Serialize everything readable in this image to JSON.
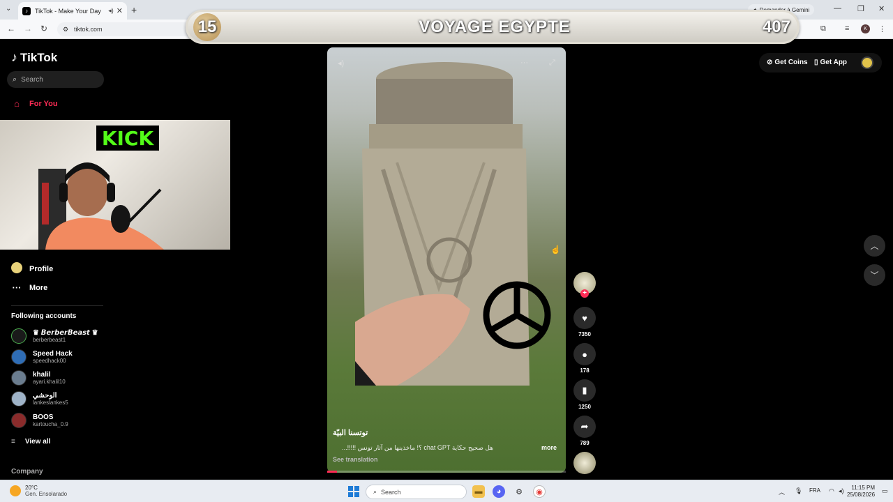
{
  "browser": {
    "tab_title": "TikTok - Make Your Day",
    "url": "tiktok.com",
    "gemini_label": "Demander à Gemini"
  },
  "overlay": {
    "number": "15",
    "title": "VOYAGE EGYPTE",
    "score": "407"
  },
  "sidebar": {
    "logo": "TikTok",
    "search_placeholder": "Search",
    "items": {
      "for_you": "For You",
      "profile": "Profile",
      "more": "More"
    },
    "following_title": "Following accounts",
    "accounts": [
      {
        "name": "♛ 𝘽𝙚𝙧𝙗𝙚𝙧𝘽𝙚𝙖𝙨𝙩 ♛",
        "username": "berberbeast1",
        "color": "#1a1a1a"
      },
      {
        "name": "Speed Hack",
        "username": "speedhack00",
        "color": "#2f6db5"
      },
      {
        "name": "khalil",
        "username": "ayari.khalil10",
        "color": "#6b7d8f"
      },
      {
        "name": "الوحشي",
        "username": "lankeslankes5",
        "color": "#9fb3c8"
      },
      {
        "name": "BOOS",
        "username": "kartoucha_0.9",
        "color": "#8a2b2b"
      }
    ],
    "view_all": "View all",
    "company": "Company",
    "webcam_sign": "KICK"
  },
  "video": {
    "author": "توتسنا البيّة",
    "caption": "هل صحيح حكاية chat GPT ؟! ماخذينها من آثار تونس !!!!!...",
    "more": "more",
    "see_translation": "See translation",
    "progress": 0.04
  },
  "actions": {
    "likes": "7350",
    "comments": "178",
    "saves": "1250",
    "shares": "789"
  },
  "header": {
    "get_coins": "Get Coins",
    "get_app": "Get App"
  },
  "taskbar": {
    "temperature": "20°C",
    "weather": "Gen. Ensolarado",
    "search": "Search",
    "lang": "FRA",
    "time": "11:15 PM",
    "date": "25/08/2026"
  }
}
